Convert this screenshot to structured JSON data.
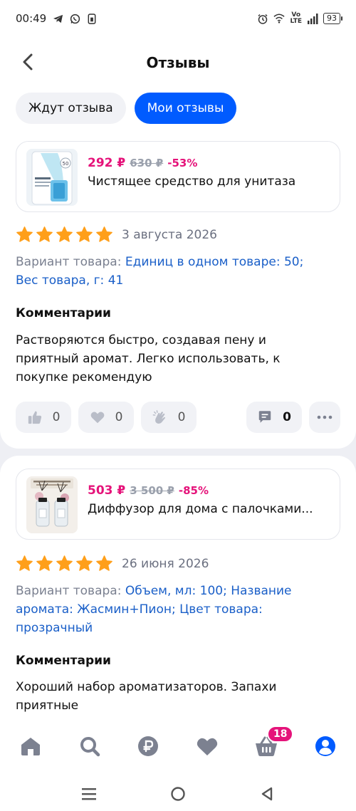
{
  "status_bar": {
    "time": "00:49",
    "left_icons": [
      "telegram-icon",
      "whatsapp-icon",
      "sim-icon"
    ],
    "right_icons": [
      "alarm-icon",
      "wifi-icon",
      "volte-icon",
      "signal-icon"
    ],
    "volte_top": "Vo",
    "volte_bottom": "LTE",
    "battery": "93"
  },
  "header": {
    "title": "Отзывы"
  },
  "tabs": [
    {
      "label": "Ждут отзыва",
      "active": false
    },
    {
      "label": "Мои отзывы",
      "active": true
    }
  ],
  "reviews": [
    {
      "product": {
        "price_now": "292 ₽",
        "price_old": "630 ₽",
        "discount": "-53%",
        "name": "Чистящее средство для унитаза"
      },
      "rating": 5,
      "date": "3 августа 2026",
      "variant_label": "Вариант товара: ",
      "variant_value": "Единиц в одном товаре: 50; Вес товара, г: 41",
      "comment_title": "Комментарии",
      "comment": "Растворяются быстро, создавая пену и приятный аромат. Легко использовать, к покупке рекомендую",
      "likes": "0",
      "hearts": "0",
      "claps": "0",
      "comments": "0"
    },
    {
      "product": {
        "price_now": "503 ₽",
        "price_old": "3 500 ₽",
        "discount": "-85%",
        "name": "Диффузор для дома с палочками..."
      },
      "rating": 5,
      "date": "26 июня 2026",
      "variant_label": "Вариант товара: ",
      "variant_value": "Объем, мл: 100; Название аромата: Жасмин+Пион; Цвет товара: прозрачный",
      "comment_title": "Комментарии",
      "comment": "Хороший набор ароматизаторов. Запахи приятные"
    }
  ],
  "bottom_nav": {
    "items": [
      "home-icon",
      "search-icon",
      "ruble-icon",
      "favorites-icon",
      "cart-icon",
      "profile-icon"
    ],
    "cart_badge": "18"
  },
  "colors": {
    "accent": "#005bff",
    "price": "#e5137a",
    "star": "#ff9f1a",
    "link": "#1a5fc8"
  }
}
